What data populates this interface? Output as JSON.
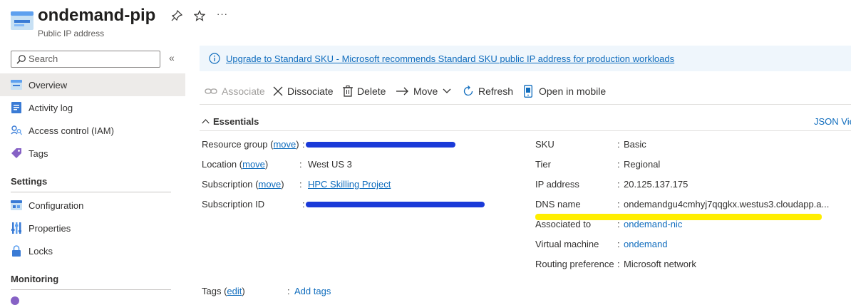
{
  "header": {
    "title": "ondemand-pip",
    "subtitle": "Public IP address",
    "pin_icon": "pin-icon",
    "favorite_icon": "star-icon",
    "more_label": "···"
  },
  "sidebar": {
    "search": {
      "placeholder": "Search",
      "value": ""
    },
    "collapse_label": "«",
    "items": [
      {
        "label": "Overview",
        "icon": "overview-icon",
        "active": true
      },
      {
        "label": "Activity log",
        "icon": "activity-log-icon"
      },
      {
        "label": "Access control (IAM)",
        "icon": "iam-icon"
      },
      {
        "label": "Tags",
        "icon": "tag-icon"
      }
    ],
    "settings_heading": "Settings",
    "settings_items": [
      {
        "label": "Configuration",
        "icon": "configuration-icon"
      },
      {
        "label": "Properties",
        "icon": "properties-icon"
      },
      {
        "label": "Locks",
        "icon": "lock-icon"
      }
    ],
    "monitoring_heading": "Monitoring"
  },
  "banner": {
    "text": "Upgrade to Standard SKU - Microsoft recommends Standard SKU public IP address for production workloads",
    "icon": "info-icon"
  },
  "toolbar": {
    "associate": "Associate",
    "dissociate": "Dissociate",
    "delete": "Delete",
    "move": "Move",
    "refresh": "Refresh",
    "open_in_mobile": "Open in mobile"
  },
  "essentials": {
    "heading": "Essentials",
    "json_view": "JSON Vie",
    "left": {
      "resource_group": {
        "label": "Resource group",
        "move": "move",
        "value": ""
      },
      "location": {
        "label": "Location",
        "move": "move",
        "value": "West US 3"
      },
      "subscription": {
        "label": "Subscription",
        "move": "move",
        "value": "HPC Skilling Project"
      },
      "subscription_id": {
        "label": "Subscription ID",
        "value": ""
      }
    },
    "right": {
      "sku": {
        "label": "SKU",
        "value": "Basic"
      },
      "tier": {
        "label": "Tier",
        "value": "Regional"
      },
      "ip_address": {
        "label": "IP address",
        "value": "20.125.137.175"
      },
      "dns_name": {
        "label": "DNS name",
        "value": "ondemandgu4cmhyj7qqgkx.westus3.cloudapp.a..."
      },
      "associated_to": {
        "label": "Associated to",
        "value": "ondemand-nic"
      },
      "virtual_machine": {
        "label": "Virtual machine",
        "value": "ondemand"
      },
      "routing_preference": {
        "label": "Routing preference",
        "value": "Microsoft network"
      }
    },
    "tags": {
      "label": "Tags",
      "edit": "edit",
      "value": "Add tags"
    }
  },
  "colors": {
    "link": "#0f6cbd",
    "banner_bg": "#eff6fc",
    "selected_bg": "#edebe9",
    "redaction": "#1a3ad8",
    "highlight": "#ffee00"
  }
}
